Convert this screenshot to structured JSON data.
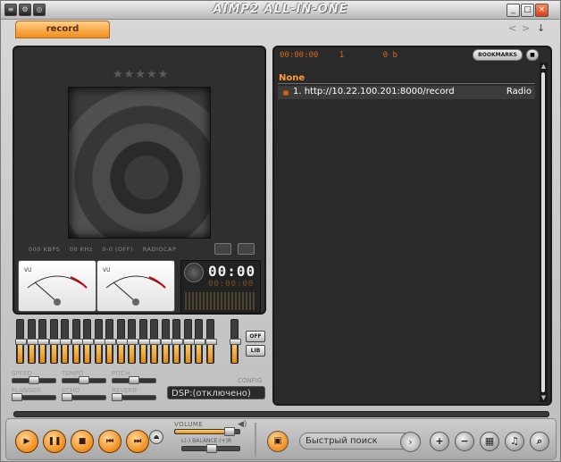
{
  "window": {
    "title": "AIMP2 ALL-IN-ONE",
    "buttons": {
      "menu_icon": "≡",
      "minimize": "_",
      "maximize": "□",
      "close": "×"
    }
  },
  "tabs": [
    {
      "label": "record"
    }
  ],
  "nav": {
    "prev": "<",
    "next": ">",
    "menu": "↓"
  },
  "now_playing": {
    "stars": "★★★★★",
    "info": {
      "kbps": "000 KBPS",
      "khz": "00 KHz",
      "eq": "0-0 (OFF)",
      "radio": "RADIOCAP"
    },
    "time_main": "00:00",
    "time_sub": "00:00:00"
  },
  "vu": {
    "left_label": "VU",
    "right_label": "VU"
  },
  "eq": {
    "bands": [
      0.5,
      0.5,
      0.5,
      0.5,
      0.5,
      0.5,
      0.5,
      0.5,
      0.5,
      0.5,
      0.5,
      0.5,
      0.5,
      0.5,
      0.5,
      0.5,
      0.5,
      0.5
    ],
    "preamp": 0.5,
    "off_label": "OFF",
    "lib_label": "LIB"
  },
  "effects": [
    {
      "label": "SPEED",
      "value": 0.5
    },
    {
      "label": "TEMPO",
      "value": 0.5
    },
    {
      "label": "PITCH",
      "value": 0.5
    },
    {
      "label": "FLANGER",
      "value": 0.0
    },
    {
      "label": "ECHO",
      "value": 0.0
    },
    {
      "label": "REVERB",
      "value": 0.0
    }
  ],
  "config": {
    "label": "CONFIG",
    "dsp": "DSP:(отключено)"
  },
  "playlist": {
    "duration": "00:00:00",
    "count": "1",
    "size": "0 b",
    "bookmarks_label": "BOOKMARKS",
    "group": "None",
    "tracks": [
      {
        "title": "1. http://10.22.100.201:8000/record",
        "type": "Radio"
      }
    ]
  },
  "controls": {
    "play": "▶",
    "pause": "❚❚",
    "stop": "■",
    "prev": "⏮",
    "next": "⏭",
    "volume_label": "VOLUME",
    "volume": 0.88,
    "balance_label": "L(-)  BALANCE  (+)R",
    "balance": 0.5,
    "search_placeholder": "Быстрый поиск",
    "add": "+",
    "remove": "−",
    "sort": "▦",
    "misc": "♫",
    "find": "⌕"
  },
  "colors": {
    "accent": "#f08c1c",
    "playlist_text": "#ffffff",
    "group": "#ff9a33"
  }
}
